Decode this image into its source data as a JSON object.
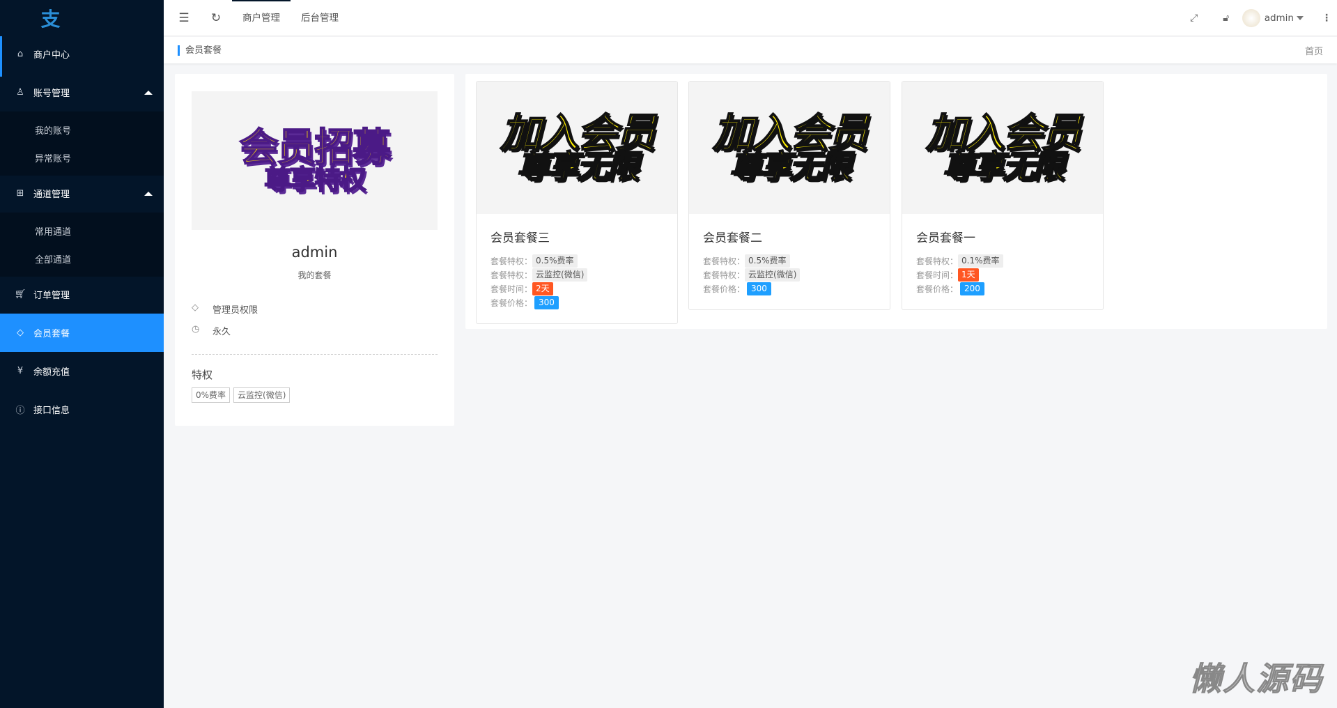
{
  "logo": "支",
  "sidebar": {
    "items": [
      {
        "label": "商户中心",
        "icon": "home-icon"
      },
      {
        "label": "账号管理",
        "icon": "user-icon",
        "children": [
          "我的账号",
          "异常账号"
        ]
      },
      {
        "label": "通道管理",
        "icon": "apps-icon",
        "children": [
          "常用通道",
          "全部通道"
        ]
      },
      {
        "label": "订单管理",
        "icon": "cart-icon"
      },
      {
        "label": "会员套餐",
        "icon": "diamond-icon",
        "active": true
      },
      {
        "label": "余额充值",
        "icon": "yen-icon"
      },
      {
        "label": "接口信息",
        "icon": "info-icon"
      }
    ]
  },
  "header": {
    "tabs": [
      "商户管理",
      "后台管理"
    ],
    "user": "admin"
  },
  "breadcrumb": {
    "current": "会员套餐",
    "home": "首页"
  },
  "profile": {
    "image_text": [
      "会员招募",
      "尊享特权"
    ],
    "name": "admin",
    "subtitle": "我的套餐",
    "role": "管理员权限",
    "duration": "永久",
    "privilege_title": "特权",
    "privileges": [
      "0%费率",
      "云监控(微信)"
    ]
  },
  "card_image_text": [
    "加入会员",
    "尊享无限"
  ],
  "packages": [
    {
      "title": "会员套餐三",
      "rows": [
        {
          "label": "套餐特权：",
          "value": "0.5%费率",
          "type": "gray"
        },
        {
          "label": "套餐特权：",
          "value": "云监控(微信)",
          "type": "gray"
        },
        {
          "label": "套餐时间：",
          "value": "2天",
          "type": "red"
        },
        {
          "label": "套餐价格：",
          "value": "300",
          "type": "blue"
        }
      ]
    },
    {
      "title": "会员套餐二",
      "rows": [
        {
          "label": "套餐特权：",
          "value": "0.5%费率",
          "type": "gray"
        },
        {
          "label": "套餐特权：",
          "value": "云监控(微信)",
          "type": "gray"
        },
        {
          "label": "套餐价格：",
          "value": "300",
          "type": "blue"
        }
      ]
    },
    {
      "title": "会员套餐一",
      "rows": [
        {
          "label": "套餐特权：",
          "value": "0.1%费率",
          "type": "gray"
        },
        {
          "label": "套餐时间：",
          "value": "1天",
          "type": "red"
        },
        {
          "label": "套餐价格：",
          "value": "200",
          "type": "blue"
        }
      ]
    }
  ],
  "watermark": "懒人源码"
}
